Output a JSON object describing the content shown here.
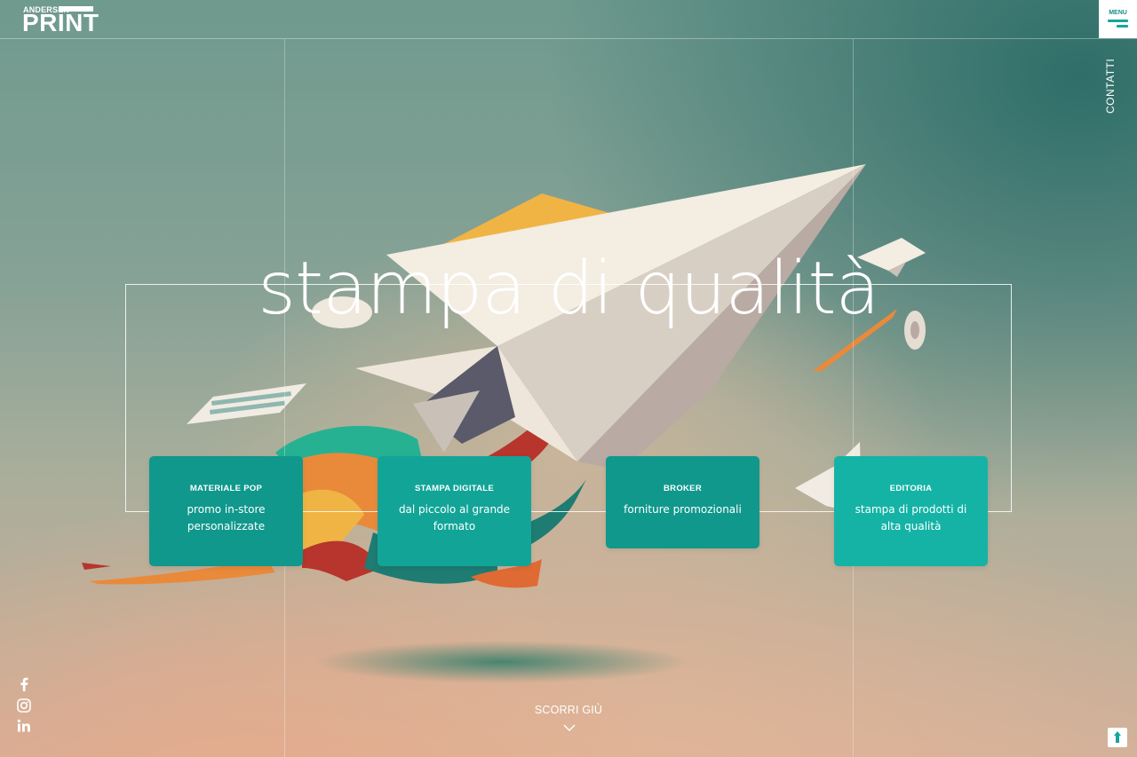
{
  "header": {
    "logo_top": "ANDERSEN",
    "logo_main": "PRINT",
    "menu_label": "MENU",
    "contatti_label": "CONTATTI"
  },
  "hero": {
    "title": "stampa di qualità"
  },
  "cards": [
    {
      "title": "MATERIALE POP",
      "subtitle": "promo in-store personalizzate"
    },
    {
      "title": "STAMPA DIGITALE",
      "subtitle": "dal piccolo al grande formato"
    },
    {
      "title": "BROKER",
      "subtitle": "forniture promozionali"
    },
    {
      "title": "EDITORIA",
      "subtitle": "stampa di prodotti di alta qualità"
    }
  ],
  "social": [
    "facebook-icon",
    "instagram-icon",
    "linkedin-icon"
  ],
  "scroll": {
    "label": "SCORRI GIÙ"
  },
  "colors": {
    "accent": "#10988c",
    "accent_light": "#14b3a6",
    "menu_bar": "#17a59c"
  }
}
